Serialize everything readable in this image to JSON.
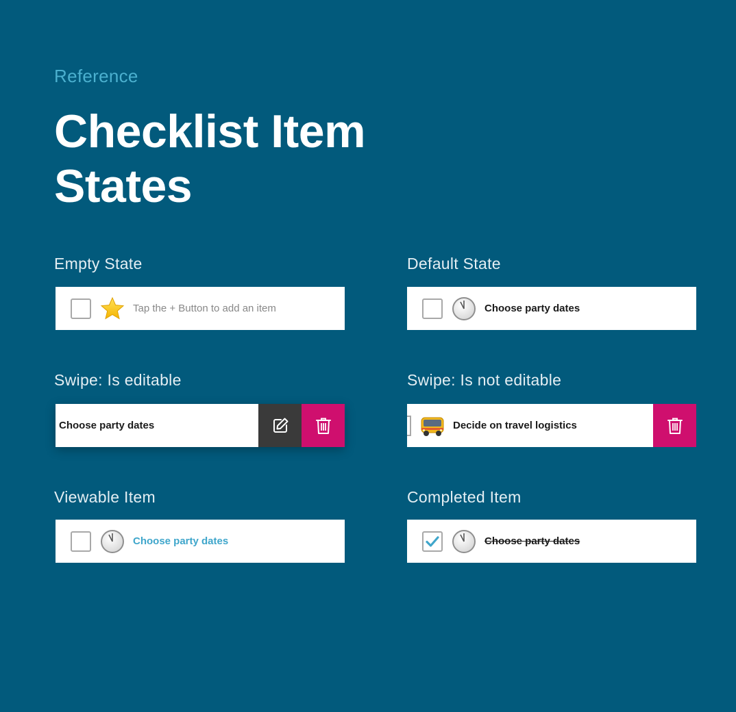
{
  "header": {
    "eyebrow": "Reference",
    "title": "Checklist Item States"
  },
  "colors": {
    "background": "#025a7c",
    "accent_blue": "#3fa6cb",
    "delete_magenta": "#cf0f6e",
    "edit_dark": "#3a3a3a"
  },
  "sections": {
    "empty": {
      "label": "Empty State",
      "icon": "star-icon",
      "text": "Tap the + Button to add an item"
    },
    "default": {
      "label": "Default State",
      "icon": "clock-icon",
      "text": "Choose party dates"
    },
    "swipe_editable": {
      "label": "Swipe: Is editable",
      "text": "Choose party dates",
      "actions": [
        "edit-icon",
        "trash-icon"
      ]
    },
    "swipe_not_editable": {
      "label": "Swipe: Is not editable",
      "icon": "bus-icon",
      "text": "Decide on travel logistics",
      "actions": [
        "trash-icon"
      ]
    },
    "viewable": {
      "label": "Viewable Item",
      "icon": "clock-icon",
      "text": "Choose party dates"
    },
    "completed": {
      "label": "Completed Item",
      "icon": "clock-icon",
      "text": "Choose party dates",
      "checked": true
    }
  }
}
